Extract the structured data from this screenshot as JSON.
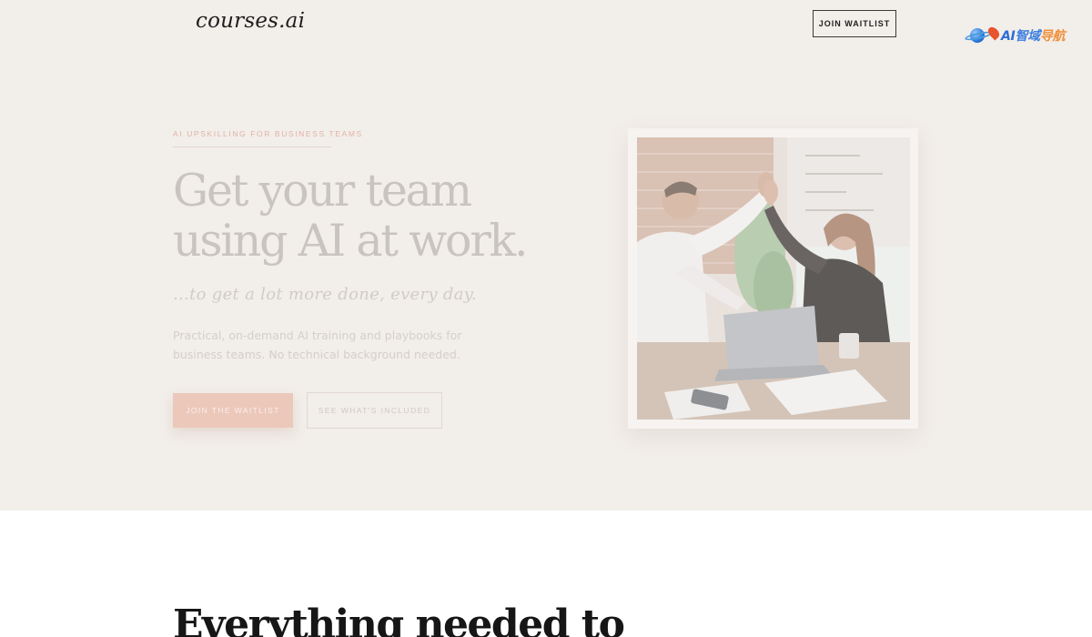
{
  "header": {
    "logo": "courses.ai",
    "cta_label": "JOIN WAITLIST",
    "badge": {
      "part1": "AI",
      "part2": "智域",
      "part3": "导航"
    }
  },
  "hero": {
    "eyebrow": "AI UPSKILLING FOR BUSINESS TEAMS",
    "title_line1": "Get your team",
    "title_line2": "using AI at work.",
    "subtitle": "...to get a lot more done, every day.",
    "description": "Practical, on-demand AI training and playbooks for business teams. No technical background needed.",
    "primary_button": "JOIN THE WAITLIST",
    "secondary_button": "SEE WHAT'S INCLUDED"
  },
  "features": {
    "title": "Everything needed to"
  },
  "colors": {
    "hero_bg": "#f2eeea",
    "accent": "#ecc8bb",
    "eyebrow": "#e2b2a6"
  }
}
